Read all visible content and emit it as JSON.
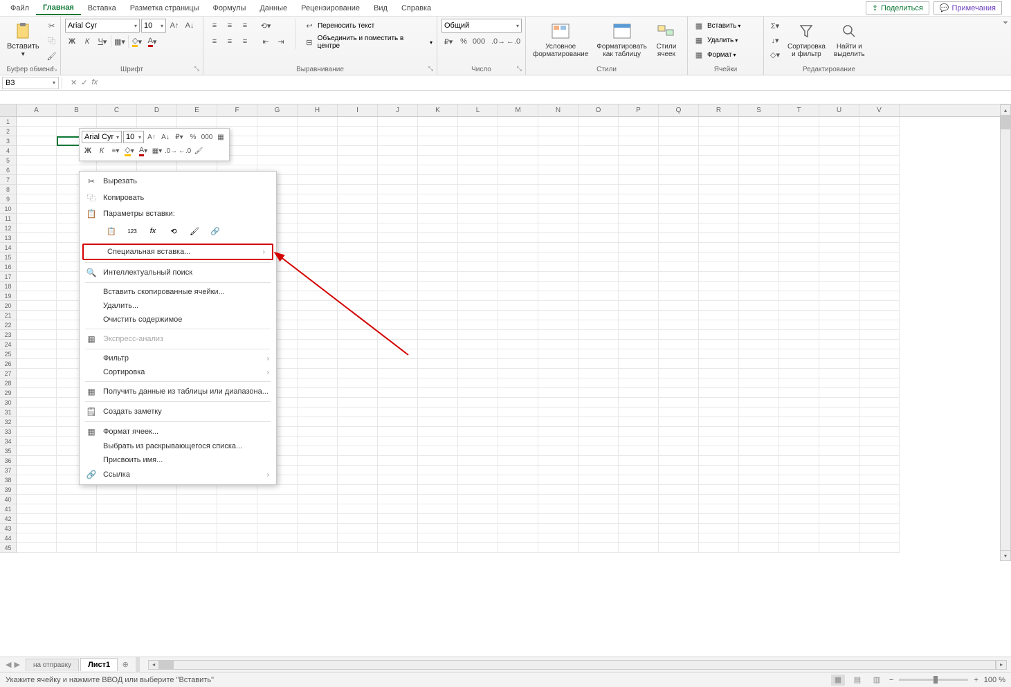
{
  "menu": {
    "items": [
      "Файл",
      "Главная",
      "Вставка",
      "Разметка страницы",
      "Формулы",
      "Данные",
      "Рецензирование",
      "Вид",
      "Справка"
    ],
    "active": 1,
    "share": "Поделиться",
    "comments": "Примечания"
  },
  "ribbon": {
    "clipboard": {
      "paste": "Вставить",
      "label": "Буфер обмена"
    },
    "font": {
      "name": "Arial Cyr",
      "size": "10",
      "label": "Шрифт"
    },
    "align": {
      "wrap": "Переносить текст",
      "merge": "Объединить и поместить в центре",
      "label": "Выравнивание"
    },
    "number": {
      "format": "Общий",
      "label": "Число"
    },
    "styles": {
      "cond": "Условное\nформатирование",
      "table": "Форматировать\nкак таблицу",
      "cell": "Стили\nячеек",
      "label": "Стили"
    },
    "cells": {
      "ins": "Вставить",
      "del": "Удалить",
      "fmt": "Формат",
      "label": "Ячейки"
    },
    "editing": {
      "sort": "Сортировка\nи фильтр",
      "find": "Найти и\nвыделить",
      "label": "Редактирование"
    }
  },
  "namebox": "B3",
  "minitb": {
    "font": "Arial Cyr",
    "size": "10"
  },
  "ctx": {
    "cut": "Вырезать",
    "copy": "Копировать",
    "pasteopt": "Параметры вставки:",
    "pastespecial": "Специальная вставка...",
    "smartlookup": "Интеллектуальный поиск",
    "inscopied": "Вставить скопированные ячейки...",
    "delete": "Удалить...",
    "clear": "Очистить содержимое",
    "quick": "Экспресс-анализ",
    "filter": "Фильтр",
    "sort": "Сортировка",
    "getdata": "Получить данные из таблицы или диапазона...",
    "newnote": "Создать заметку",
    "fmtcells": "Формат ячеек...",
    "dropdown": "Выбрать из раскрывающегося списка...",
    "defname": "Присвоить имя...",
    "link": "Ссылка"
  },
  "columns": [
    "A",
    "B",
    "C",
    "D",
    "E",
    "F",
    "G",
    "H",
    "I",
    "J",
    "K",
    "L",
    "M",
    "N",
    "O",
    "P",
    "Q",
    "R",
    "S",
    "T",
    "U",
    "V"
  ],
  "sheets": {
    "tab1": "на отправку",
    "tab2": "Лист1"
  },
  "status": {
    "msg": "Укажите ячейку и нажмите ВВОД или выберите \"Вставить\"",
    "zoom": "100 %"
  }
}
